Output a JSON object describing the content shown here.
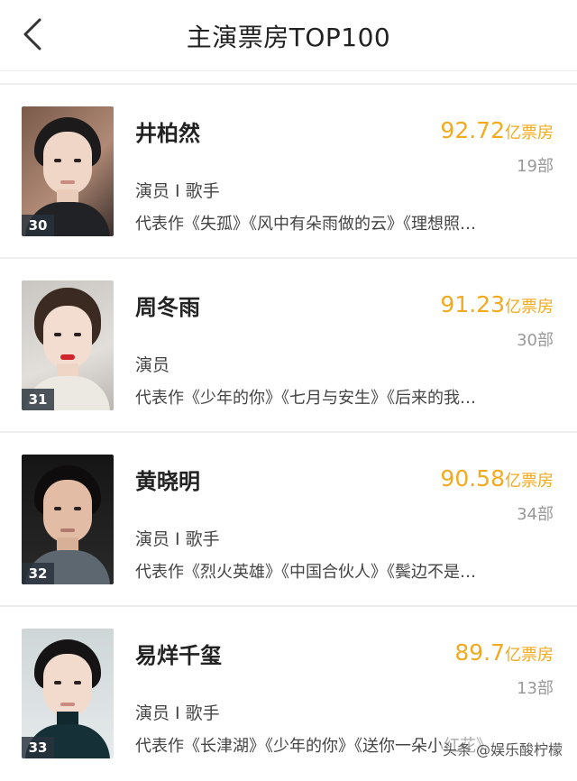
{
  "header": {
    "title": "主演票房TOP100"
  },
  "actors": [
    {
      "rank": "30",
      "name": "井柏然",
      "box_value": "92.72",
      "box_unit": "亿票房",
      "count": "19部",
      "role": "演员 I 歌手",
      "works": "代表作《失孤》《风中有朵雨做的云》《理想照…"
    },
    {
      "rank": "31",
      "name": "周冬雨",
      "box_value": "91.23",
      "box_unit": "亿票房",
      "count": "30部",
      "role": "演员",
      "works": "代表作《少年的你》《七月与安生》《后来的我…"
    },
    {
      "rank": "32",
      "name": "黄晓明",
      "box_value": "90.58",
      "box_unit": "亿票房",
      "count": "34部",
      "role": "演员 I 歌手",
      "works": "代表作《烈火英雄》《中国合伙人》《鬓边不是…"
    },
    {
      "rank": "33",
      "name": "易烊千玺",
      "box_value": "89.7",
      "box_unit": "亿票房",
      "count": "13部",
      "role": "演员 I 歌手",
      "works": "代表作《长津湖》《少年的你》《送你一朵小红花》"
    }
  ],
  "watermark": "头条 @娱乐酸柠檬",
  "colors": {
    "accent": "#f2aa1e",
    "rank_badge": "#283240"
  }
}
